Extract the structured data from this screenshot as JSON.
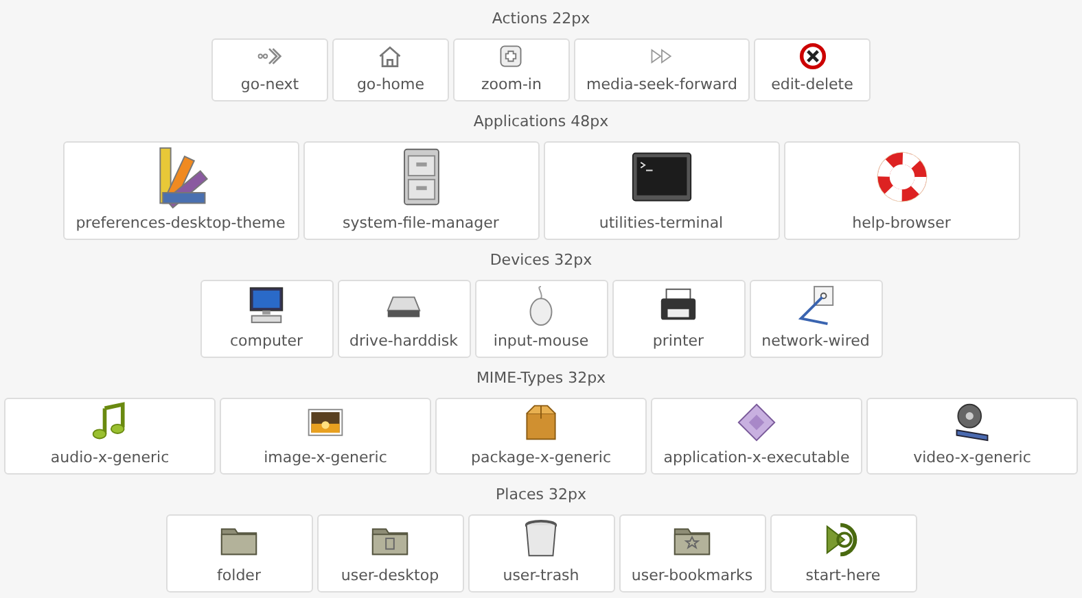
{
  "sections": [
    {
      "heading": "Actions 22px",
      "items": [
        "go-next",
        "go-home",
        "zoom-in",
        "media-seek-forward",
        "edit-delete"
      ]
    },
    {
      "heading": "Applications 48px",
      "items": [
        "preferences-desktop-theme",
        "system-file-manager",
        "utilities-terminal",
        "help-browser"
      ]
    },
    {
      "heading": "Devices 32px",
      "items": [
        "computer",
        "drive-harddisk",
        "input-mouse",
        "printer",
        "network-wired"
      ]
    },
    {
      "heading": "MIME-Types 32px",
      "items": [
        "audio-x-generic",
        "image-x-generic",
        "package-x-generic",
        "application-x-executable",
        "video-x-generic"
      ]
    },
    {
      "heading": "Places 32px",
      "items": [
        "folder",
        "user-desktop",
        "user-trash",
        "user-bookmarks",
        "start-here"
      ]
    }
  ]
}
